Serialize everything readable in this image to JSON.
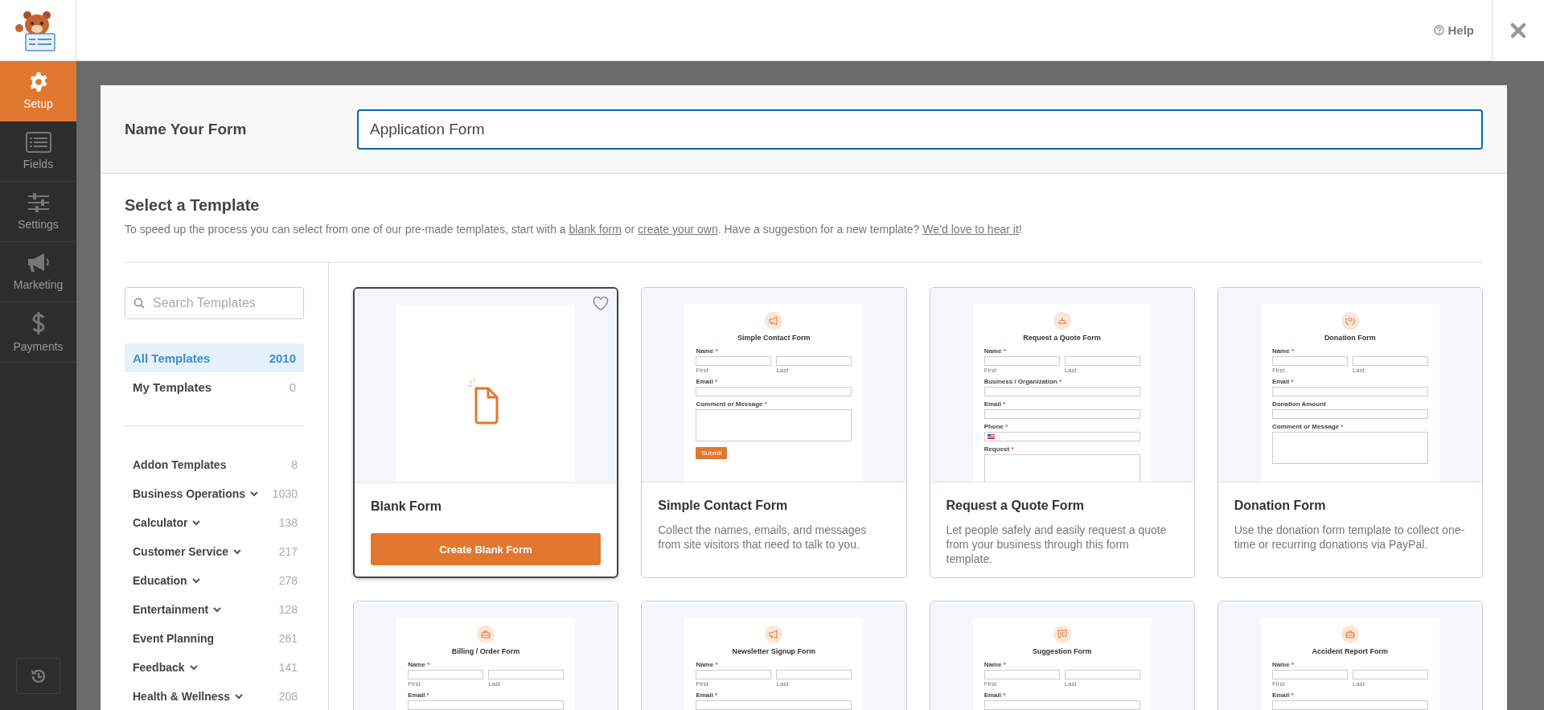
{
  "header": {
    "help": "Help"
  },
  "nav": [
    {
      "label": "Setup",
      "selected": true
    },
    {
      "label": "Fields",
      "selected": false
    },
    {
      "label": "Settings",
      "selected": false
    },
    {
      "label": "Marketing",
      "selected": false
    },
    {
      "label": "Payments",
      "selected": false
    }
  ],
  "name_form": {
    "label": "Name Your Form",
    "value": "Application Form"
  },
  "template_section": {
    "title": "Select a Template",
    "intro": [
      {
        "kind": "text",
        "text": "To speed up the process you can select from one of our pre-made templates, start with a "
      },
      {
        "kind": "link",
        "text": "blank form"
      },
      {
        "kind": "text",
        "text": " or "
      },
      {
        "kind": "link",
        "text": "create your own"
      },
      {
        "kind": "text",
        "text": ". Have a suggestion for a new template? "
      },
      {
        "kind": "link",
        "text": "We’d love to hear it"
      },
      {
        "kind": "text",
        "text": "!"
      }
    ]
  },
  "search": {
    "placeholder": "Search Templates"
  },
  "filters": [
    {
      "label": "All Templates",
      "count": "2010",
      "selected": true
    },
    {
      "label": "My Templates",
      "count": "0",
      "selected": false
    }
  ],
  "categories": [
    {
      "label": "Addon Templates",
      "count": "8",
      "expandable": false
    },
    {
      "label": "Business Operations",
      "count": "1030",
      "expandable": true
    },
    {
      "label": "Calculator",
      "count": "138",
      "expandable": true
    },
    {
      "label": "Customer Service",
      "count": "217",
      "expandable": true
    },
    {
      "label": "Education",
      "count": "278",
      "expandable": true
    },
    {
      "label": "Entertainment",
      "count": "128",
      "expandable": true
    },
    {
      "label": "Event Planning",
      "count": "261",
      "expandable": false
    },
    {
      "label": "Feedback",
      "count": "141",
      "expandable": true
    },
    {
      "label": "Health & Wellness",
      "count": "208",
      "expandable": true
    }
  ],
  "cards": [
    {
      "title": "Blank Form",
      "selected": true,
      "button": "Create Blank Form",
      "preview": {
        "kind": "blank"
      }
    },
    {
      "title": "Simple Contact Form",
      "selected": false,
      "description": "Collect the names, emails, and messages from site visitors that need to talk to you.",
      "preview": {
        "kind": "form",
        "title": "Simple Contact Form",
        "fields": [
          {
            "kind": "name",
            "label": "Name",
            "asterisk": "*",
            "sublabels": [
              "First",
              "Last"
            ]
          },
          {
            "kind": "text",
            "label": "Email",
            "asterisk": "*"
          },
          {
            "kind": "textarea",
            "label": "Comment or Message",
            "asterisk": "*"
          }
        ],
        "submit": "Submit"
      }
    },
    {
      "title": "Request a Quote Form",
      "selected": false,
      "description": "Let people safely and easily request a quote from your business through this form template.",
      "preview": {
        "kind": "form",
        "title": "Request a Quote Form",
        "fields": [
          {
            "kind": "name",
            "label": "Name",
            "asterisk": "*",
            "sublabels": [
              "First",
              "Last"
            ]
          },
          {
            "kind": "text",
            "label": "Business / Organization",
            "asterisk": "*"
          },
          {
            "kind": "text",
            "label": "Email",
            "asterisk": "*"
          },
          {
            "kind": "phone",
            "label": "Phone",
            "asterisk": "*"
          },
          {
            "kind": "textarea",
            "label": "Request",
            "asterisk": "*"
          }
        ]
      }
    },
    {
      "title": "Donation Form",
      "selected": false,
      "description": "Use the donation form template to collect one-time or recurring donations via PayPal.",
      "preview": {
        "kind": "form",
        "title": "Donation Form",
        "fields": [
          {
            "kind": "name",
            "label": "Name",
            "asterisk": "*",
            "sublabels": [
              "First",
              "Last"
            ]
          },
          {
            "kind": "text",
            "label": "Email",
            "asterisk": "*"
          },
          {
            "kind": "text",
            "label": "Donation Amount"
          },
          {
            "kind": "textarea",
            "label": "Comment or Message",
            "asterisk": "*"
          }
        ]
      }
    },
    {
      "selected": false,
      "preview": {
        "kind": "form",
        "title": "Billing / Order Form",
        "fields": [
          {
            "kind": "name",
            "label": "Name",
            "asterisk": "*",
            "sublabels": [
              "First",
              "Last"
            ]
          },
          {
            "kind": "text",
            "label": "Email",
            "asterisk": "*"
          }
        ]
      }
    },
    {
      "selected": false,
      "preview": {
        "kind": "form",
        "title": "Newsletter Signup Form",
        "fields": [
          {
            "kind": "name",
            "label": "Name",
            "asterisk": "*",
            "sublabels": [
              "First",
              "Last"
            ]
          },
          {
            "kind": "text",
            "label": "Email",
            "asterisk": "*"
          }
        ]
      }
    },
    {
      "selected": false,
      "preview": {
        "kind": "form",
        "title": "Suggestion Form",
        "fields": [
          {
            "kind": "name",
            "label": "Name",
            "asterisk": "*",
            "sublabels": [
              "First",
              "Last"
            ]
          },
          {
            "kind": "text",
            "label": "Email",
            "asterisk": "*"
          }
        ]
      }
    },
    {
      "selected": false,
      "preview": {
        "kind": "form",
        "title": "Accident Report Form",
        "fields": [
          {
            "kind": "name",
            "label": "Name",
            "asterisk": "*",
            "sublabels": [
              "First",
              "Last"
            ]
          },
          {
            "kind": "text",
            "label": "Email",
            "asterisk": "*"
          }
        ]
      }
    }
  ]
}
